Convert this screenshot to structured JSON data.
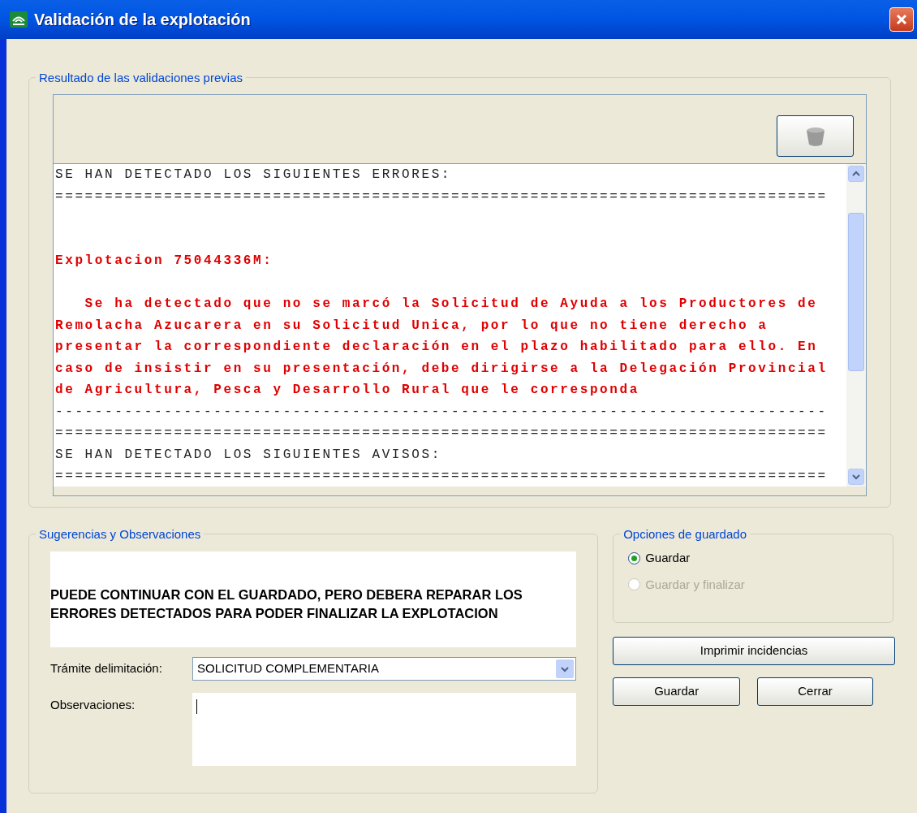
{
  "window": {
    "title": "Validación de la explotación"
  },
  "results_group": {
    "legend": "Resultado de las validaciones previas",
    "lines": [
      {
        "kind": "normal",
        "text": "SE HAN DETECTADO LOS SIGUIENTES ERRORES:"
      },
      {
        "kind": "normal",
        "text": "=============================================================================="
      },
      {
        "kind": "blank"
      },
      {
        "kind": "blank"
      },
      {
        "kind": "error",
        "text": "Explotacion 75044336M:"
      },
      {
        "kind": "blank"
      },
      {
        "kind": "error",
        "text": "   Se ha detectado que no se marcó la Solicitud de Ayuda a los Productores de"
      },
      {
        "kind": "error",
        "text": "Remolacha Azucarera en su Solicitud Unica, por lo que no tiene derecho a"
      },
      {
        "kind": "error",
        "text": "presentar la correspondiente declaración en el plazo habilitado para ello. En"
      },
      {
        "kind": "error",
        "text": "caso de insistir en su presentación, debe dirigirse a la Delegación Provincial"
      },
      {
        "kind": "error",
        "text": "de Agricultura, Pesca y Desarrollo Rural que le corresponda"
      },
      {
        "kind": "normal",
        "text": "------------------------------------------------------------------------------"
      },
      {
        "kind": "normal",
        "text": "=============================================================================="
      },
      {
        "kind": "normal",
        "text": "SE HAN DETECTADO LOS SIGUIENTES AVISOS:"
      },
      {
        "kind": "normal",
        "text": "=============================================================================="
      }
    ]
  },
  "suggestions_group": {
    "legend": "Sugerencias y Observaciones",
    "message": "PUEDE CONTINUAR CON EL GUARDADO, PERO DEBERA REPARAR LOS ERRORES DETECTADOS PARA PODER FINALIZAR LA EXPLOTACION",
    "tramite": {
      "label": "Trámite delimitación:",
      "value": "SOLICITUD COMPLEMENTARIA"
    },
    "observaciones": {
      "label": "Observaciones:"
    }
  },
  "save_options": {
    "legend": "Opciones de guardado",
    "options": [
      {
        "label": "Guardar",
        "selected": true,
        "disabled": false
      },
      {
        "label": "Guardar y finalizar",
        "selected": false,
        "disabled": true
      }
    ]
  },
  "buttons": [
    "Imprimir incidencias",
    "Guardar",
    "Cerrar"
  ]
}
